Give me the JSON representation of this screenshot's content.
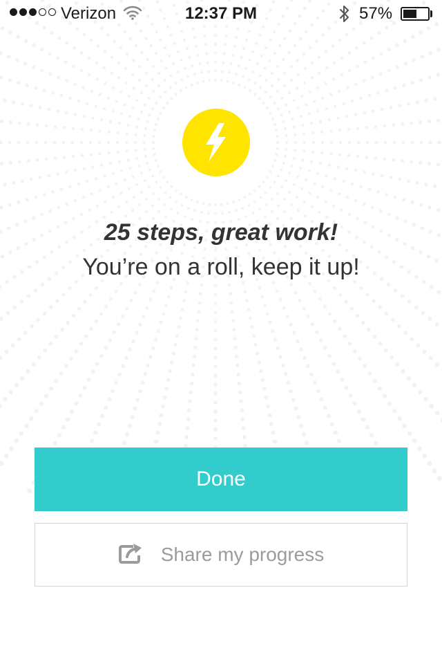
{
  "status_bar": {
    "signal_bars_filled": 3,
    "signal_bars_total": 5,
    "carrier": "Verizon",
    "wifi_icon": "wifi-icon",
    "time": "12:37 PM",
    "bluetooth_icon": "bluetooth-icon",
    "battery_percent_label": "57%",
    "battery_level": 0.57
  },
  "achievement": {
    "icon": "lightning-bolt-icon",
    "headline": "25 steps, great work!",
    "message": "You’re on a roll, keep it up!"
  },
  "actions": {
    "done_label": "Done",
    "share_label": "Share my progress",
    "share_icon": "share-external-icon"
  },
  "colors": {
    "accent": "#33CCCC",
    "badge": "#FFE400",
    "bolt": "#FFFFFF",
    "text": "#333333",
    "secondary_text": "#9B9B9B",
    "burst_dots": "#F2F2F2"
  }
}
